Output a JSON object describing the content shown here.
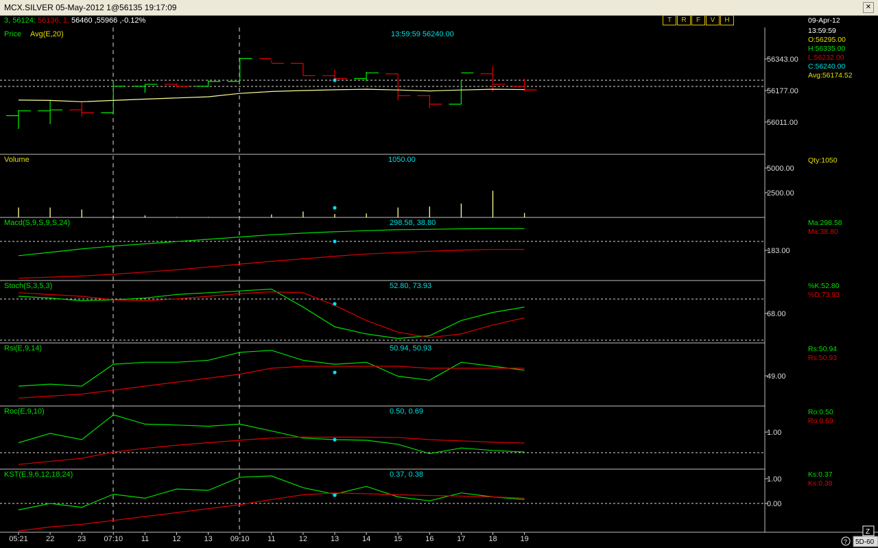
{
  "window": {
    "title": "MCX.SILVER 05-May-2012 1@56135 19:17:09"
  },
  "quote_line": {
    "part1": "3, 56124:",
    "part2": "56136, 1,",
    "part3": "56460 ,55966 ,-0.12%"
  },
  "toolbar": [
    "T",
    "R",
    "F",
    "V",
    "H"
  ],
  "panels": {
    "price": {
      "label_a": "Price",
      "label_b": "Avg(E,20)",
      "cursor_readout": "13:59:59 56240.00",
      "axis": [
        "56343.00",
        "56177.00",
        "56011.00"
      ],
      "side": {
        "date": "09-Apr-12",
        "time": "13:59:59",
        "open": "O:56295.00",
        "high": "H:56335.00",
        "low": "L:56232.00",
        "close": "C:56240.00",
        "avg": "Avg:56174.52"
      }
    },
    "volume": {
      "label": "Volume",
      "cursor_readout": "1050.00",
      "axis": [
        "5000.00",
        "2500.00"
      ],
      "side": "Qty:1050"
    },
    "macd": {
      "label": "Macd(S,9,S,9,S,24)",
      "cursor_readout": "298.58, 38.80",
      "axis": [
        "183.00"
      ],
      "side_a": "Ma:298.58",
      "side_b": "Ma:38.80"
    },
    "stoch": {
      "label": "Stoch(S,3,5,3)",
      "cursor_readout": "52.80, 73.93",
      "axis": [
        "68.00"
      ],
      "side_a": "%K:52.80",
      "side_b": "%D:73.93"
    },
    "rsi": {
      "label": "Rsi(E,9,14)",
      "cursor_readout": "50.94, 50.93",
      "axis": [
        "49.00"
      ],
      "side_a": "Rs:50.94",
      "side_b": "Rs:50.93"
    },
    "roc": {
      "label": "Roc(E,9,10)",
      "cursor_readout": "0.50, 0.69",
      "axis": [
        "1.00"
      ],
      "side_a": "Ro:0.50",
      "side_b": "Ro:0.69"
    },
    "kst": {
      "label": "KST(E,9,6,12,18,24)",
      "cursor_readout": "0.37, 0.38",
      "axis": [
        "1.00",
        "0.00"
      ],
      "side_a": "Ks:0.37",
      "side_b": "Ks:0.38"
    }
  },
  "x_axis_labels": [
    "05:21",
    "22",
    "23",
    "07:10",
    "11",
    "12",
    "13",
    "09:10",
    "11",
    "12",
    "13",
    "14",
    "15",
    "16",
    "17",
    "18",
    "19"
  ],
  "status": {
    "zoom_button": "Z",
    "period": "5D-60",
    "help": "?"
  },
  "colors": {
    "up": "#00e000",
    "down": "#e00000",
    "avg": "#ffff99",
    "label": "#e0e000",
    "readout": "#00e0e0",
    "cursor_dot": "#00e0ff"
  },
  "chart_data": {
    "type": "line",
    "x": [
      "05:21",
      "22",
      "23",
      "07:10",
      "11",
      "12",
      "13",
      "09:10",
      "11",
      "12",
      "13",
      "14",
      "15",
      "16",
      "17",
      "18",
      "19"
    ],
    "price_bars": [
      {
        "o": 56045,
        "h": 56075,
        "l": 55975,
        "c": 56070
      },
      {
        "o": 56070,
        "h": 56125,
        "l": 56000,
        "c": 56075
      },
      {
        "o": 56075,
        "h": 56115,
        "l": 56040,
        "c": 56060
      },
      {
        "o": 56060,
        "h": 56225,
        "l": 56060,
        "c": 56200
      },
      {
        "o": 56200,
        "h": 56210,
        "l": 56165,
        "c": 56210
      },
      {
        "o": 56210,
        "h": 56215,
        "l": 56195,
        "c": 56200
      },
      {
        "o": 56200,
        "h": 56230,
        "l": 56195,
        "c": 56225
      },
      {
        "o": 56225,
        "h": 56345,
        "l": 56225,
        "c": 56345
      },
      {
        "o": 56345,
        "h": 56335,
        "l": 56325,
        "c": 56320
      },
      {
        "o": 56320,
        "h": 56320,
        "l": 56255,
        "c": 56255
      },
      {
        "o": 56255,
        "h": 56285,
        "l": 56240,
        "c": 56240
      },
      {
        "o": 56240,
        "h": 56275,
        "l": 56225,
        "c": 56270
      },
      {
        "o": 56265,
        "h": 56265,
        "l": 56125,
        "c": 56150
      },
      {
        "o": 56150,
        "h": 56155,
        "l": 56085,
        "c": 56105
      },
      {
        "o": 56105,
        "h": 56230,
        "l": 56105,
        "c": 56270
      },
      {
        "o": 56265,
        "h": 56305,
        "l": 56170,
        "c": 56210
      },
      {
        "o": 56200,
        "h": 56240,
        "l": 56175,
        "c": 56180
      }
    ],
    "avg": [
      56127,
      56125,
      56118,
      56125,
      56132,
      56138,
      56144,
      56162,
      56172,
      56177,
      56181,
      56184,
      56180,
      56175,
      56180,
      56184,
      56182
    ],
    "volume": [
      1000,
      1000,
      800,
      200,
      200,
      50,
      50,
      50,
      300,
      600,
      350,
      400,
      1000,
      1100,
      1400,
      2700,
      450
    ],
    "macd_ma": [
      40,
      70,
      100,
      125,
      145,
      165,
      185,
      205,
      225,
      240,
      252,
      262,
      270,
      274,
      278,
      281,
      280
    ],
    "macd_signal": [
      -160,
      -150,
      -140,
      -125,
      -105,
      -85,
      -60,
      -35,
      -10,
      12,
      35,
      55,
      68,
      80,
      90,
      95,
      95
    ],
    "stoch_k": [
      82,
      80,
      77,
      78,
      80,
      84,
      86,
      88,
      90,
      70,
      48,
      40,
      35,
      38,
      55,
      64,
      70
    ],
    "stoch_d": [
      86,
      84,
      82,
      78,
      77,
      79,
      82,
      85,
      87,
      86,
      72,
      55,
      42,
      36,
      40,
      50,
      58
    ],
    "rsi_fast": [
      40,
      41,
      40,
      51,
      52,
      52,
      53,
      57,
      58,
      53,
      51,
      52,
      45,
      43,
      52,
      50,
      48
    ],
    "rsi_slow": [
      34,
      35,
      36,
      38,
      40,
      42,
      44,
      46,
      49,
      50,
      50,
      50,
      50,
      49,
      49,
      49,
      49
    ],
    "roc_fast": [
      0.4,
      0.7,
      0.5,
      1.3,
      1.0,
      0.97,
      0.93,
      1.0,
      0.78,
      0.55,
      0.5,
      0.48,
      0.35,
      0.05,
      0.23,
      0.15,
      0.1
    ],
    "roc_slow": [
      -0.3,
      -0.2,
      -0.1,
      0.1,
      0.22,
      0.32,
      0.4,
      0.48,
      0.55,
      0.58,
      0.58,
      0.58,
      0.57,
      0.5,
      0.46,
      0.42,
      0.39
    ],
    "kst_fast": [
      -0.3,
      -0.05,
      -0.2,
      0.3,
      0.15,
      0.5,
      0.45,
      0.95,
      1.0,
      0.55,
      0.3,
      0.6,
      0.2,
      0.05,
      0.35,
      0.2,
      0.1
    ],
    "kst_slow": [
      -1.1,
      -0.95,
      -0.85,
      -0.7,
      -0.55,
      -0.4,
      -0.25,
      -0.1,
      0.1,
      0.28,
      0.35,
      0.32,
      0.28,
      0.25,
      0.23,
      0.2,
      0.15
    ],
    "cursor_x_index": 10
  }
}
